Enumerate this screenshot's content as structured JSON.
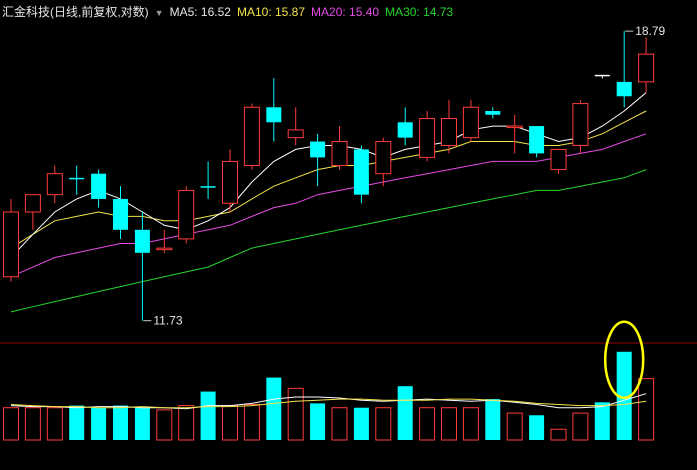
{
  "header": {
    "title": "汇金科技(日线,前复权,对数)",
    "ma5": "MA5: 16.52",
    "ma10": "MA10: 15.87",
    "ma20": "MA20: 15.40",
    "ma30": "MA30: 14.73"
  },
  "colors": {
    "up": "#ff3b3b",
    "down": "#00ffff",
    "ma5": "#ffffff",
    "ma10": "#f3e24a",
    "ma20": "#e64be6",
    "ma30": "#27d62b",
    "highlight": "#ffff00",
    "divider": "#8b0000"
  },
  "chart_data": {
    "type": "candlestick",
    "price_scale": "log",
    "annotations": {
      "high_label": "18.79",
      "low_label": "11.73"
    },
    "candles": [
      {
        "open": 12.6,
        "high": 14.3,
        "low": 12.5,
        "close": 14.0,
        "dir": "up"
      },
      {
        "open": 14.0,
        "high": 14.4,
        "low": 13.6,
        "close": 14.4,
        "dir": "up"
      },
      {
        "open": 14.4,
        "high": 15.1,
        "low": 14.2,
        "close": 14.9,
        "dir": "up"
      },
      {
        "open": 14.8,
        "high": 15.1,
        "low": 14.4,
        "close": 14.8,
        "dir": "down"
      },
      {
        "open": 14.9,
        "high": 15.0,
        "low": 14.1,
        "close": 14.3,
        "dir": "down"
      },
      {
        "open": 14.3,
        "high": 14.6,
        "low": 13.4,
        "close": 13.6,
        "dir": "down"
      },
      {
        "open": 13.6,
        "high": 14.0,
        "low": 11.73,
        "close": 13.1,
        "dir": "down"
      },
      {
        "open": 13.2,
        "high": 13.6,
        "low": 13.1,
        "close": 13.2,
        "dir": "up"
      },
      {
        "open": 13.4,
        "high": 14.6,
        "low": 13.3,
        "close": 14.5,
        "dir": "up"
      },
      {
        "open": 14.6,
        "high": 15.2,
        "low": 14.3,
        "close": 14.6,
        "dir": "down"
      },
      {
        "open": 14.2,
        "high": 15.5,
        "low": 14.0,
        "close": 15.2,
        "dir": "up"
      },
      {
        "open": 15.1,
        "high": 16.7,
        "low": 15.0,
        "close": 16.6,
        "dir": "up"
      },
      {
        "open": 16.6,
        "high": 17.4,
        "low": 15.7,
        "close": 16.2,
        "dir": "down"
      },
      {
        "open": 15.8,
        "high": 16.6,
        "low": 15.6,
        "close": 16.0,
        "dir": "up"
      },
      {
        "open": 15.7,
        "high": 15.9,
        "low": 14.6,
        "close": 15.3,
        "dir": "down"
      },
      {
        "open": 15.1,
        "high": 16.1,
        "low": 15.0,
        "close": 15.7,
        "dir": "up"
      },
      {
        "open": 15.5,
        "high": 15.6,
        "low": 14.2,
        "close": 14.4,
        "dir": "down"
      },
      {
        "open": 14.9,
        "high": 15.8,
        "low": 14.6,
        "close": 15.7,
        "dir": "up"
      },
      {
        "open": 16.2,
        "high": 16.6,
        "low": 15.6,
        "close": 15.8,
        "dir": "down"
      },
      {
        "open": 15.3,
        "high": 16.5,
        "low": 15.2,
        "close": 16.3,
        "dir": "up"
      },
      {
        "open": 15.6,
        "high": 16.8,
        "low": 15.4,
        "close": 16.3,
        "dir": "up"
      },
      {
        "open": 15.8,
        "high": 16.8,
        "low": 15.7,
        "close": 16.6,
        "dir": "up"
      },
      {
        "open": 16.5,
        "high": 16.6,
        "low": 16.3,
        "close": 16.4,
        "dir": "down"
      },
      {
        "open": 16.1,
        "high": 16.4,
        "low": 15.4,
        "close": 16.1,
        "dir": "up"
      },
      {
        "open": 16.1,
        "high": 16.1,
        "low": 15.3,
        "close": 15.4,
        "dir": "down"
      },
      {
        "open": 15.0,
        "high": 15.5,
        "low": 14.9,
        "close": 15.5,
        "dir": "up"
      },
      {
        "open": 15.6,
        "high": 16.8,
        "low": 15.4,
        "close": 16.7,
        "dir": "up"
      },
      {
        "open": 17.5,
        "high": 17.5,
        "low": 17.4,
        "close": 17.5,
        "dir": "doji"
      },
      {
        "open": 17.3,
        "high": 18.79,
        "low": 16.6,
        "close": 16.9,
        "dir": "down"
      },
      {
        "open": 17.3,
        "high": 18.6,
        "low": 17.0,
        "close": 18.1,
        "dir": "up"
      }
    ],
    "ma5": [
      13.0,
      13.5,
      14.0,
      14.3,
      14.5,
      14.3,
      14.0,
      13.7,
      13.6,
      13.8,
      14.1,
      14.7,
      15.2,
      15.5,
      15.6,
      15.6,
      15.5,
      15.3,
      15.5,
      15.6,
      15.7,
      16.0,
      16.1,
      16.1,
      15.9,
      15.7,
      15.8,
      16.1,
      16.5,
      17.0
    ],
    "ma10": [
      13.2,
      13.5,
      13.8,
      13.9,
      14.0,
      13.9,
      13.9,
      13.8,
      13.8,
      13.9,
      14.0,
      14.3,
      14.6,
      14.8,
      15.0,
      15.1,
      15.1,
      15.2,
      15.3,
      15.4,
      15.5,
      15.7,
      15.7,
      15.7,
      15.6,
      15.6,
      15.7,
      15.9,
      16.2,
      16.5
    ],
    "ma20": [
      12.6,
      12.8,
      13.0,
      13.1,
      13.2,
      13.3,
      13.3,
      13.4,
      13.5,
      13.6,
      13.7,
      13.9,
      14.1,
      14.2,
      14.4,
      14.5,
      14.6,
      14.7,
      14.8,
      14.9,
      15.0,
      15.1,
      15.2,
      15.2,
      15.2,
      15.3,
      15.4,
      15.5,
      15.7,
      15.9
    ],
    "ma30": [
      11.9,
      12.0,
      12.1,
      12.2,
      12.3,
      12.4,
      12.5,
      12.6,
      12.7,
      12.8,
      13.0,
      13.2,
      13.3,
      13.4,
      13.5,
      13.6,
      13.7,
      13.8,
      13.9,
      14.0,
      14.1,
      14.2,
      14.3,
      14.4,
      14.5,
      14.5,
      14.6,
      14.7,
      14.8,
      15.0
    ],
    "volume": [
      3.0,
      3.0,
      3.0,
      3.2,
      3.0,
      3.2,
      3.0,
      2.8,
      3.2,
      4.5,
      3.2,
      3.3,
      5.8,
      4.8,
      3.4,
      3.0,
      3.0,
      3.0,
      5.0,
      3.0,
      3.0,
      3.0,
      3.8,
      2.5,
      2.3,
      1.0,
      2.5,
      3.5,
      8.2,
      5.7
    ],
    "volume_ma": [
      3.2,
      3.1,
      3.1,
      3.0,
      3.1,
      3.1,
      3.0,
      3.0,
      2.9,
      3.2,
      3.2,
      3.4,
      3.8,
      4.0,
      4.0,
      3.9,
      3.7,
      3.6,
      3.7,
      3.8,
      3.7,
      3.6,
      3.7,
      3.5,
      3.3,
      3.0,
      3.0,
      3.1,
      3.7,
      4.3
    ],
    "volume_ma2": [
      3.3,
      3.2,
      3.1,
      3.1,
      3.0,
      3.0,
      3.1,
      3.0,
      3.0,
      3.1,
      3.1,
      3.2,
      3.4,
      3.6,
      3.7,
      3.8,
      3.8,
      3.7,
      3.7,
      3.7,
      3.8,
      3.8,
      3.7,
      3.6,
      3.4,
      3.3,
      3.2,
      3.2,
      3.3,
      3.6
    ]
  }
}
